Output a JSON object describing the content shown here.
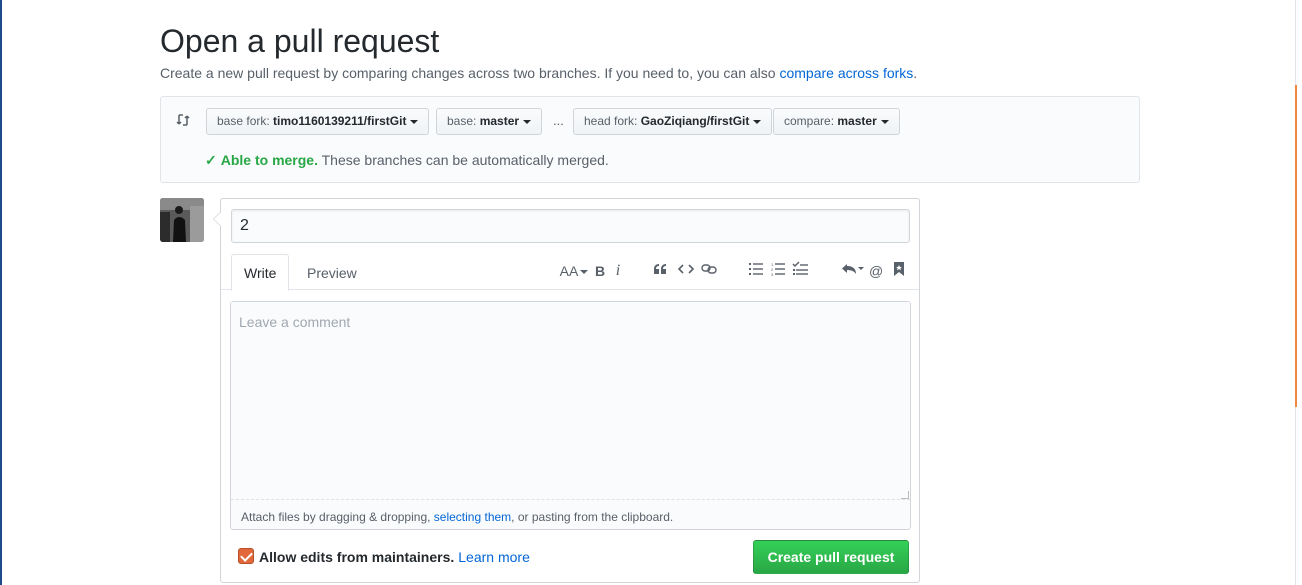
{
  "header": {
    "title": "Open a pull request",
    "subtitle": "Create a new pull request by comparing changes across two branches. If you need to, you can also",
    "subtitle_link": "compare across forks",
    "subtitle_end": "."
  },
  "range": {
    "base_fork_label": "base fork:",
    "base_fork_value": "timo1160139211/firstGit",
    "base_label": "base:",
    "base_value": "master",
    "ellipsis": "...",
    "head_fork_label": "head fork:",
    "head_fork_value": "GaoZiqiang/firstGit",
    "compare_label": "compare:",
    "compare_value": "master",
    "merge_ok": "Able to merge.",
    "merge_msg": "These branches can be automatically merged."
  },
  "form": {
    "title_value": "2",
    "tabs": [
      {
        "label": "Write"
      },
      {
        "label": "Preview"
      }
    ],
    "comment_placeholder": "Leave a comment",
    "attach_prefix": "Attach files by dragging & dropping, ",
    "attach_link": "selecting them",
    "attach_suffix": ", or pasting from the clipboard.",
    "allow_edits_label": "Allow edits from maintainers.",
    "learn_more": "Learn more",
    "create_button": "Create pull request",
    "toolbar": {
      "heading": "AA",
      "bold": "B",
      "italic": "i",
      "mention": "@"
    }
  },
  "colors": {
    "accent_green": "#28a745",
    "link_blue": "#0366d6",
    "checkbox_orange": "#e2673a"
  }
}
